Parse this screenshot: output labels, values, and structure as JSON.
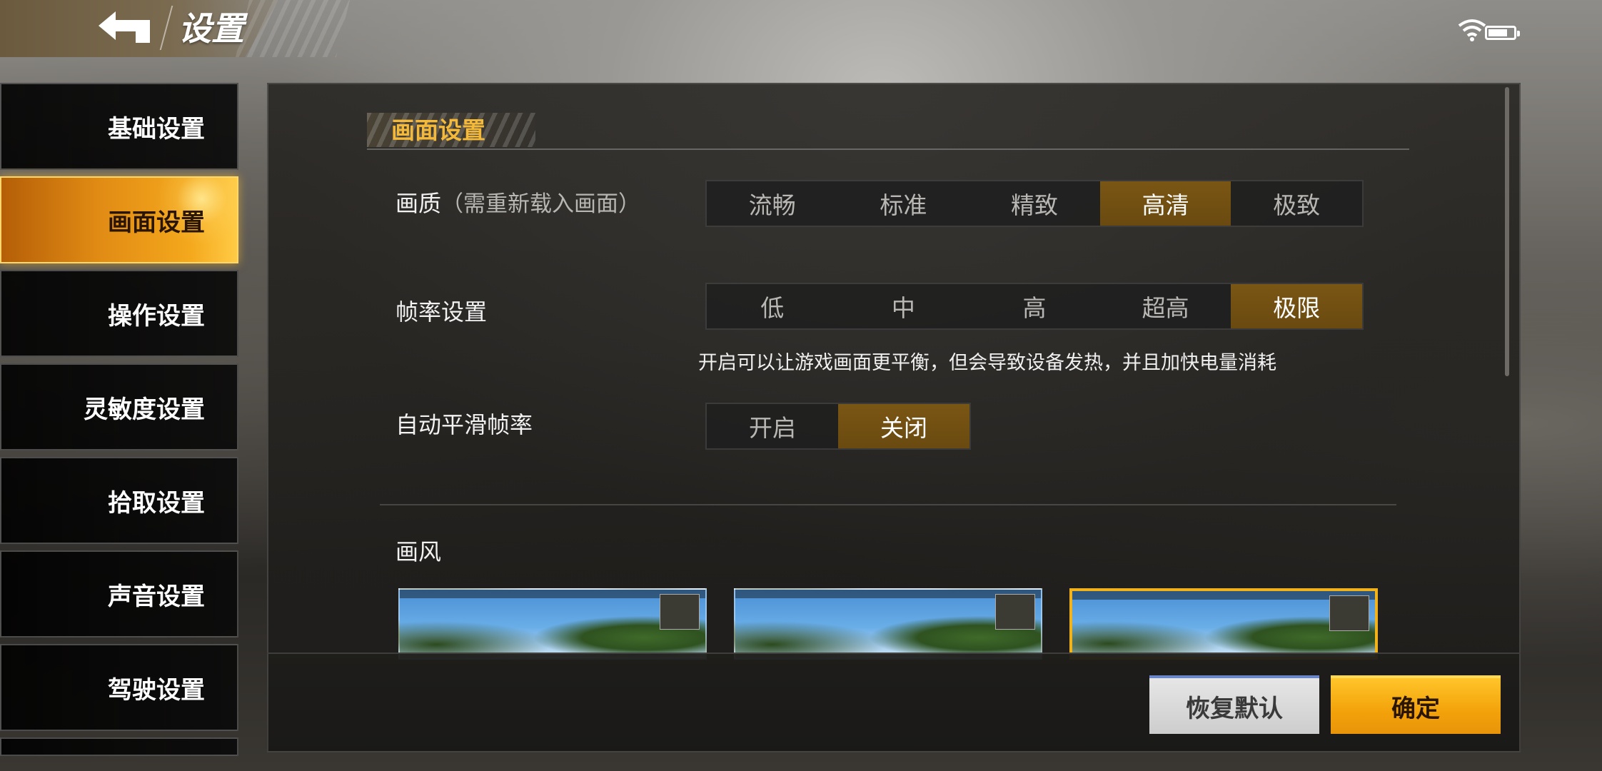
{
  "header": {
    "title": "设置",
    "back_icon": "back-arrow-icon"
  },
  "status": {
    "wifi_icon": "wifi-icon",
    "battery_icon": "battery-icon"
  },
  "sidebar": {
    "items": [
      {
        "label": "基础设置",
        "active": false
      },
      {
        "label": "画面设置",
        "active": true
      },
      {
        "label": "操作设置",
        "active": false
      },
      {
        "label": "灵敏度设置",
        "active": false
      },
      {
        "label": "拾取设置",
        "active": false
      },
      {
        "label": "声音设置",
        "active": false
      },
      {
        "label": "驾驶设置",
        "active": false
      }
    ]
  },
  "section": {
    "title": "画面设置"
  },
  "quality": {
    "label": "画质",
    "note": "（需重新载入画面）",
    "options": [
      "流畅",
      "标准",
      "精致",
      "高清",
      "极致"
    ],
    "selected": "高清"
  },
  "framerate": {
    "label": "帧率设置",
    "options": [
      "低",
      "中",
      "高",
      "超高",
      "极限"
    ],
    "selected": "极限",
    "hint": "开启可以让游戏画面更平衡，但会导致设备发热，并且加快电量消耗"
  },
  "smooth": {
    "label": "自动平滑帧率",
    "options": [
      "开启",
      "关闭"
    ],
    "selected": "关闭"
  },
  "style": {
    "label": "画风",
    "selected_index": 2
  },
  "footer": {
    "reset_label": "恢复默认",
    "ok_label": "确定"
  },
  "colors": {
    "accent": "#f3a20a",
    "selected_segment": "#7a5614",
    "section_title": "#f5b93a"
  }
}
